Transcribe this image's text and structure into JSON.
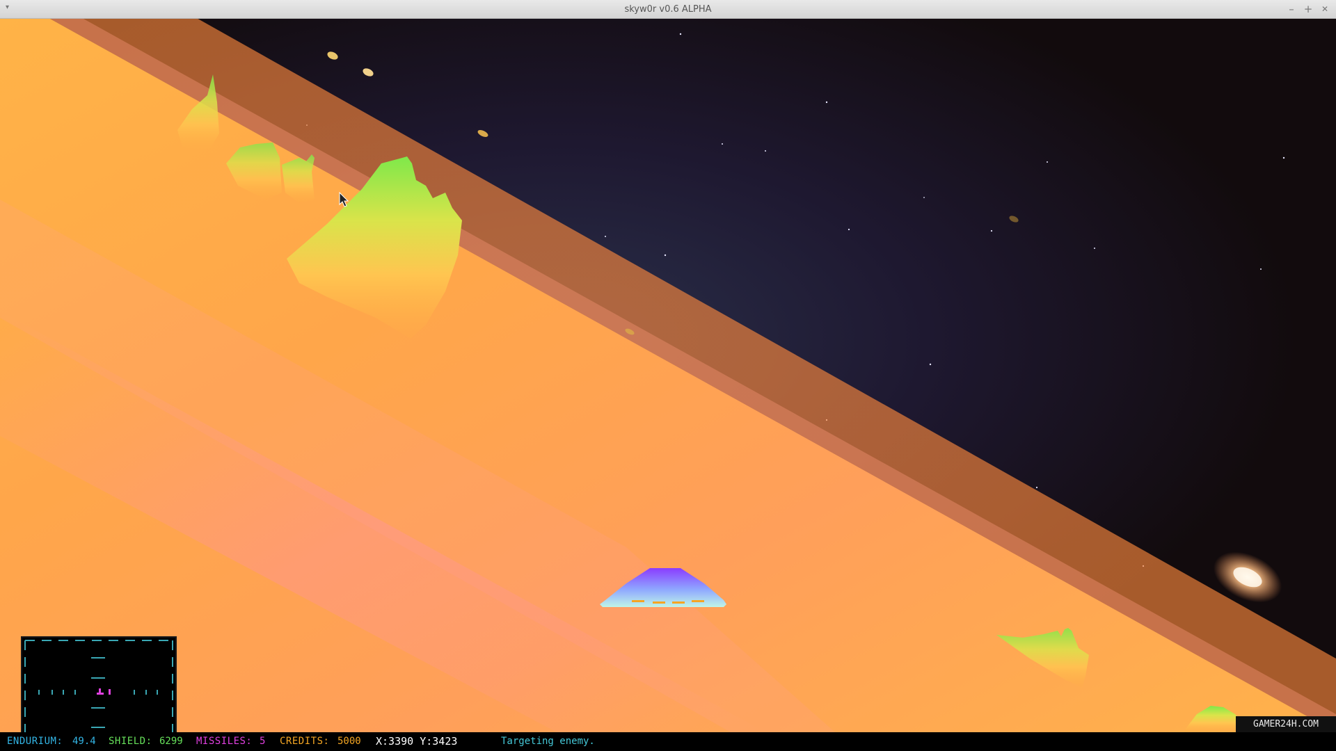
{
  "window": {
    "title": "skyw0r v0.6 ALPHA",
    "menu_icon": "chevron-down-icon",
    "minimize_glyph": "–",
    "maximize_glyph": "+",
    "close_glyph": "✕"
  },
  "hud": {
    "endurium_label": "ENDURIUM:",
    "endurium_value": "49.4",
    "shield_label": "SHIELD:",
    "shield_value": "6299",
    "missiles_label": "MISSILES:",
    "missiles_value": "5",
    "credits_label": "CREDITS:",
    "credits_value": "5000",
    "coords": "X:3390 Y:3423",
    "message": "Targeting enemy."
  },
  "watermark": "GAMER24H.COM",
  "colors": {
    "endurium": "#33b5e5",
    "shield": "#66e05a",
    "missiles": "#e040e0",
    "credits": "#f5a623",
    "coords": "#ffffff",
    "message": "#45c8d8",
    "minimap_lines": "#3aa7b4",
    "minimap_player": "#e040e0"
  }
}
